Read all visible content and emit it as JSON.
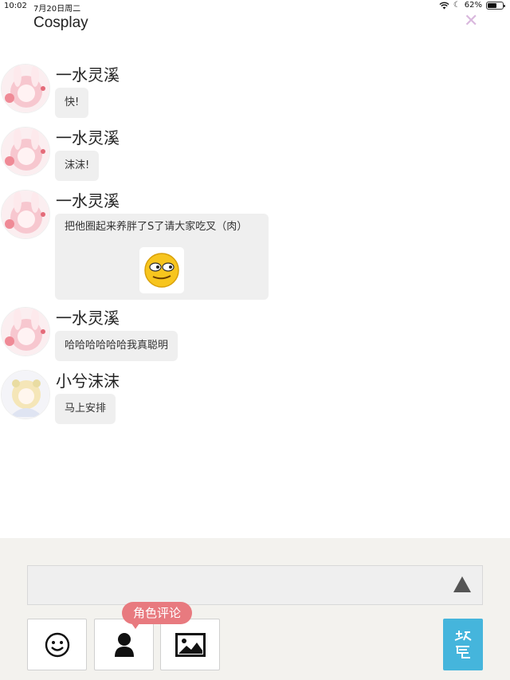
{
  "status_bar": {
    "time": "10:02",
    "date": "7月20日周二",
    "battery": "62%",
    "battery_level": 0.62
  },
  "header": {
    "title": "Cosplay"
  },
  "messages": [
    {
      "sender": "一水灵溪",
      "text": "快!",
      "avatar": "pink-anime-girl-avatar"
    },
    {
      "sender": "一水灵溪",
      "text": "沫沫!",
      "avatar": "pink-anime-girl-avatar"
    },
    {
      "sender": "一水灵溪",
      "text": "把他圈起来养胖了S了请大家吃叉（肉）",
      "avatar": "pink-anime-girl-avatar",
      "attachment": "smirk-emoji"
    },
    {
      "sender": "一水灵溪",
      "text": "哈哈哈哈哈哈我真聪明",
      "avatar": "pink-anime-girl-avatar"
    },
    {
      "sender": "小兮沫沫",
      "text": "马上安排",
      "avatar": "blonde-anime-girl-avatar"
    }
  ],
  "composer": {
    "input_value": "",
    "tooltip": "角色评论",
    "tools": [
      "smile-icon",
      "person-icon",
      "image-icon"
    ],
    "send_icon": "send-glyph-icon"
  },
  "colors": {
    "accent_send": "#45b5dc",
    "tooltip_bg": "#e87a7f",
    "bubble_bg": "#efefef",
    "close": "#d9b8dd"
  }
}
